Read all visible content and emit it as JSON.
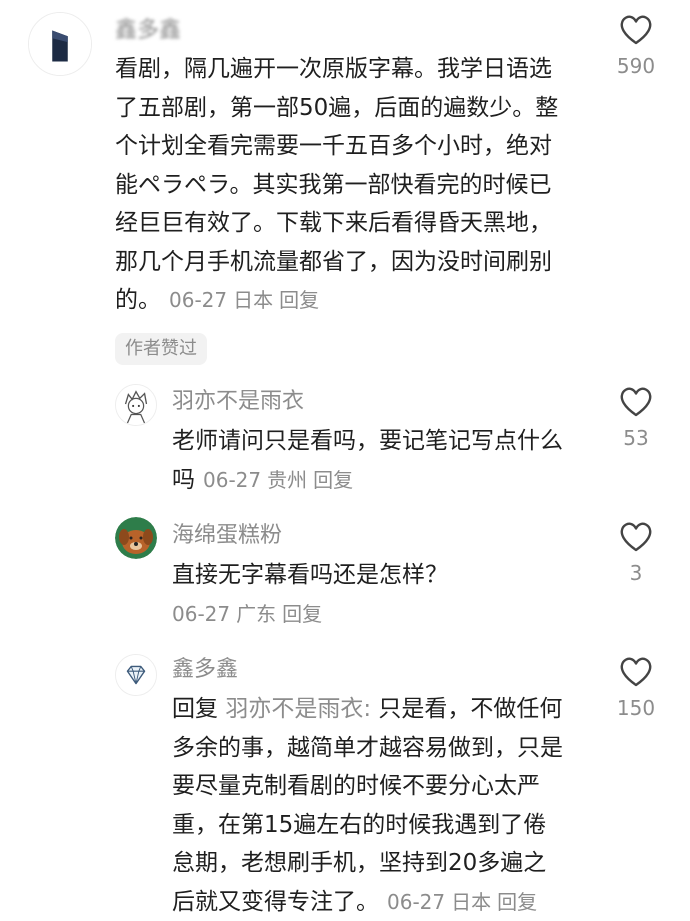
{
  "comments": [
    {
      "name": "鑫多鑫",
      "lines": [
        "看剧，隔几遍开一次原版字幕。我学日语选",
        "了五部剧，第一部50遍，后面的遍数少。整",
        "个计划全看完需要一千五百多个小时，绝对",
        "能ペラペラ。其实我第一部快看完的时候已",
        "经巨巨有效了。下载下来后看得昏天黑地，",
        "那几个月手机流量都省了，因为没时间刷别",
        "的。"
      ],
      "date": "06-27",
      "location": "日本",
      "reply_label": "回复",
      "likes": "590",
      "badge": "作者赞过"
    },
    {
      "name": "羽亦不是雨衣",
      "lines": [
        "老师请问只是看吗，要记笔记写点什么",
        "吗"
      ],
      "date": "06-27",
      "location": "贵州",
      "reply_label": "回复",
      "likes": "53"
    },
    {
      "name": "海绵蛋糕粉",
      "lines": [
        "直接无字幕看吗还是怎样？"
      ],
      "date": "06-27",
      "location": "广东",
      "reply_label": "回复",
      "likes": "3"
    },
    {
      "name": "鑫多鑫",
      "reply_prefix": "回复",
      "reply_to": "羽亦不是雨衣:",
      "lines": [
        "只是看，不做任何",
        "多余的事，越简单才越容易做到，只是",
        "要尽量克制看剧的时候不要分心太严",
        "重，在第15遍左右的时候我遇到了倦",
        "怠期，老想刷手机，坚持到20多遍之",
        "后就又变得专注了。"
      ],
      "date": "06-27",
      "location": "日本",
      "reply_label": "回复",
      "likes": "150"
    }
  ],
  "icons": {
    "like": "heart-outline-icon",
    "avatar1": "dark-square-avatar",
    "avatar2": "anime-boy-sketch-avatar",
    "avatar3": "brown-dog-avatar",
    "avatar4": "diamond-avatar"
  },
  "colors": {
    "text": "#1f1f1f",
    "muted": "#8c8c8c",
    "badge_bg": "#f2f2f2"
  }
}
